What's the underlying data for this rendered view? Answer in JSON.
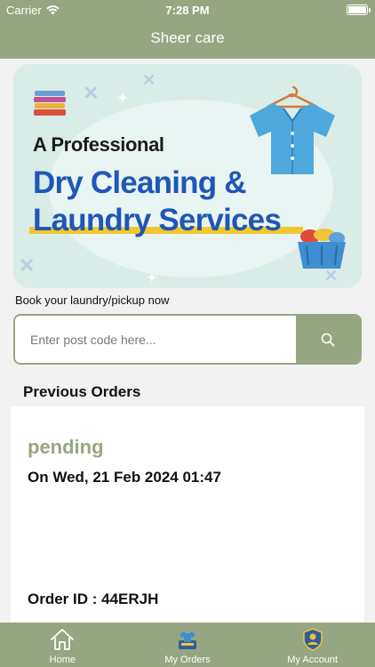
{
  "status_bar": {
    "carrier": "Carrier",
    "time": "7:28 PM"
  },
  "header": {
    "title": "Sheer care"
  },
  "banner": {
    "kicker": "A Professional",
    "headline_line1": "Dry Cleaning &",
    "headline_line2": "Laundry Services",
    "colors": {
      "headline": "#1f56b8",
      "underline": "#f2c62f",
      "background": "#d9ece8"
    }
  },
  "booking": {
    "label": "Book your laundry/pickup now",
    "postcode_placeholder": "Enter post code here...",
    "postcode_value": "",
    "search_icon": "search-icon"
  },
  "orders": {
    "section_title": "Previous Orders",
    "items": [
      {
        "status": "pending",
        "date": "On Wed, 21 Feb 2024 01:47",
        "order_id": "Order ID : 44ERJH"
      }
    ]
  },
  "tab_bar": {
    "tabs": [
      {
        "label": "Home",
        "icon": "home-icon"
      },
      {
        "label": "My Orders",
        "icon": "orders-icon"
      },
      {
        "label": "My Account",
        "icon": "account-icon"
      }
    ]
  },
  "theme": {
    "primary": "#96a682",
    "background": "#f2f2f2"
  }
}
